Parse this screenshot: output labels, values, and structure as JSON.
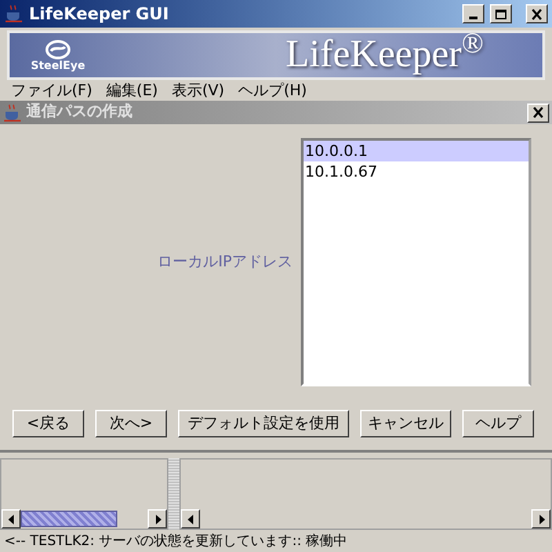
{
  "window": {
    "title": "LifeKeeper GUI"
  },
  "banner": {
    "logo": "SteelEye",
    "product": "LifeKeeper$^{®}$"
  },
  "menu": [
    "ファイル(F)",
    "編集(E)",
    "表示(V)",
    "ヘルプ(H)"
  ],
  "dialog": {
    "title": "通信パスの作成",
    "field_label": "ローカルIPアドレス",
    "list": [
      {
        "text": "10.0.0.1",
        "selected": true
      },
      {
        "text": "10.1.0.67",
        "selected": false
      }
    ],
    "buttons": [
      "<戻る",
      "次へ>",
      "デフォルト設定を使用",
      "キャンセル",
      "ヘルプ"
    ]
  },
  "status_bar": "<-- TESTLK2: サーバの状態を更新しています:: 稼働中"
}
